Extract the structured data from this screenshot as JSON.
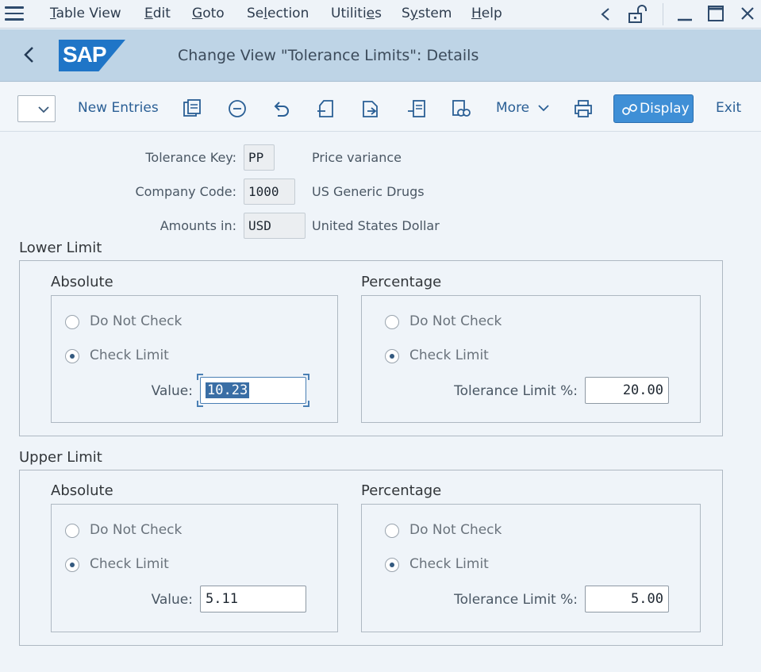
{
  "menubar": {
    "items": [
      {
        "label": "Table View",
        "key": "T"
      },
      {
        "label": "Edit",
        "key": "E"
      },
      {
        "label": "Goto",
        "key": "G"
      },
      {
        "label": "Selection",
        "key": "l"
      },
      {
        "label": "Utilities",
        "key": "e"
      },
      {
        "label": "System",
        "key": "y"
      },
      {
        "label": "Help",
        "key": "H"
      }
    ]
  },
  "titlebar": {
    "logo_text": "SAP",
    "title": "Change View \"Tolerance Limits\": Details"
  },
  "toolbar": {
    "new_entries": "New Entries",
    "more": "More",
    "display": "Display",
    "exit": "Exit"
  },
  "header": {
    "tolerance_key_label": "Tolerance Key:",
    "tolerance_key_value": "PP",
    "tolerance_key_desc": "Price variance",
    "company_code_label": "Company Code:",
    "company_code_value": "1000",
    "company_code_desc": "US Generic Drugs",
    "amounts_label": "Amounts in:",
    "amounts_value": "USD",
    "amounts_desc": "United States Dollar"
  },
  "lower_limit": {
    "title": "Lower Limit",
    "absolute": {
      "title": "Absolute",
      "option_no_check": "Do Not Check",
      "option_check": "Check Limit",
      "selected": "Check Limit",
      "value_label": "Value:",
      "value": "10.23"
    },
    "percentage": {
      "title": "Percentage",
      "option_no_check": "Do Not Check",
      "option_check": "Check Limit",
      "selected": "Check Limit",
      "value_label": "Tolerance Limit %:",
      "value": "20.00"
    }
  },
  "upper_limit": {
    "title": "Upper Limit",
    "absolute": {
      "title": "Absolute",
      "option_no_check": "Do Not Check",
      "option_check": "Check Limit",
      "selected": "Check Limit",
      "value_label": "Value:",
      "value": "5.11"
    },
    "percentage": {
      "title": "Percentage",
      "option_no_check": "Do Not Check",
      "option_check": "Check Limit",
      "selected": "Check Limit",
      "value_label": "Tolerance Limit %:",
      "value": "5.00"
    }
  },
  "colors": {
    "menubar_bg": "#eef3f8",
    "titlebar_bg": "#bed4e6",
    "sap_blue": "#1f75c7",
    "display_button": "#3f8fd6"
  }
}
